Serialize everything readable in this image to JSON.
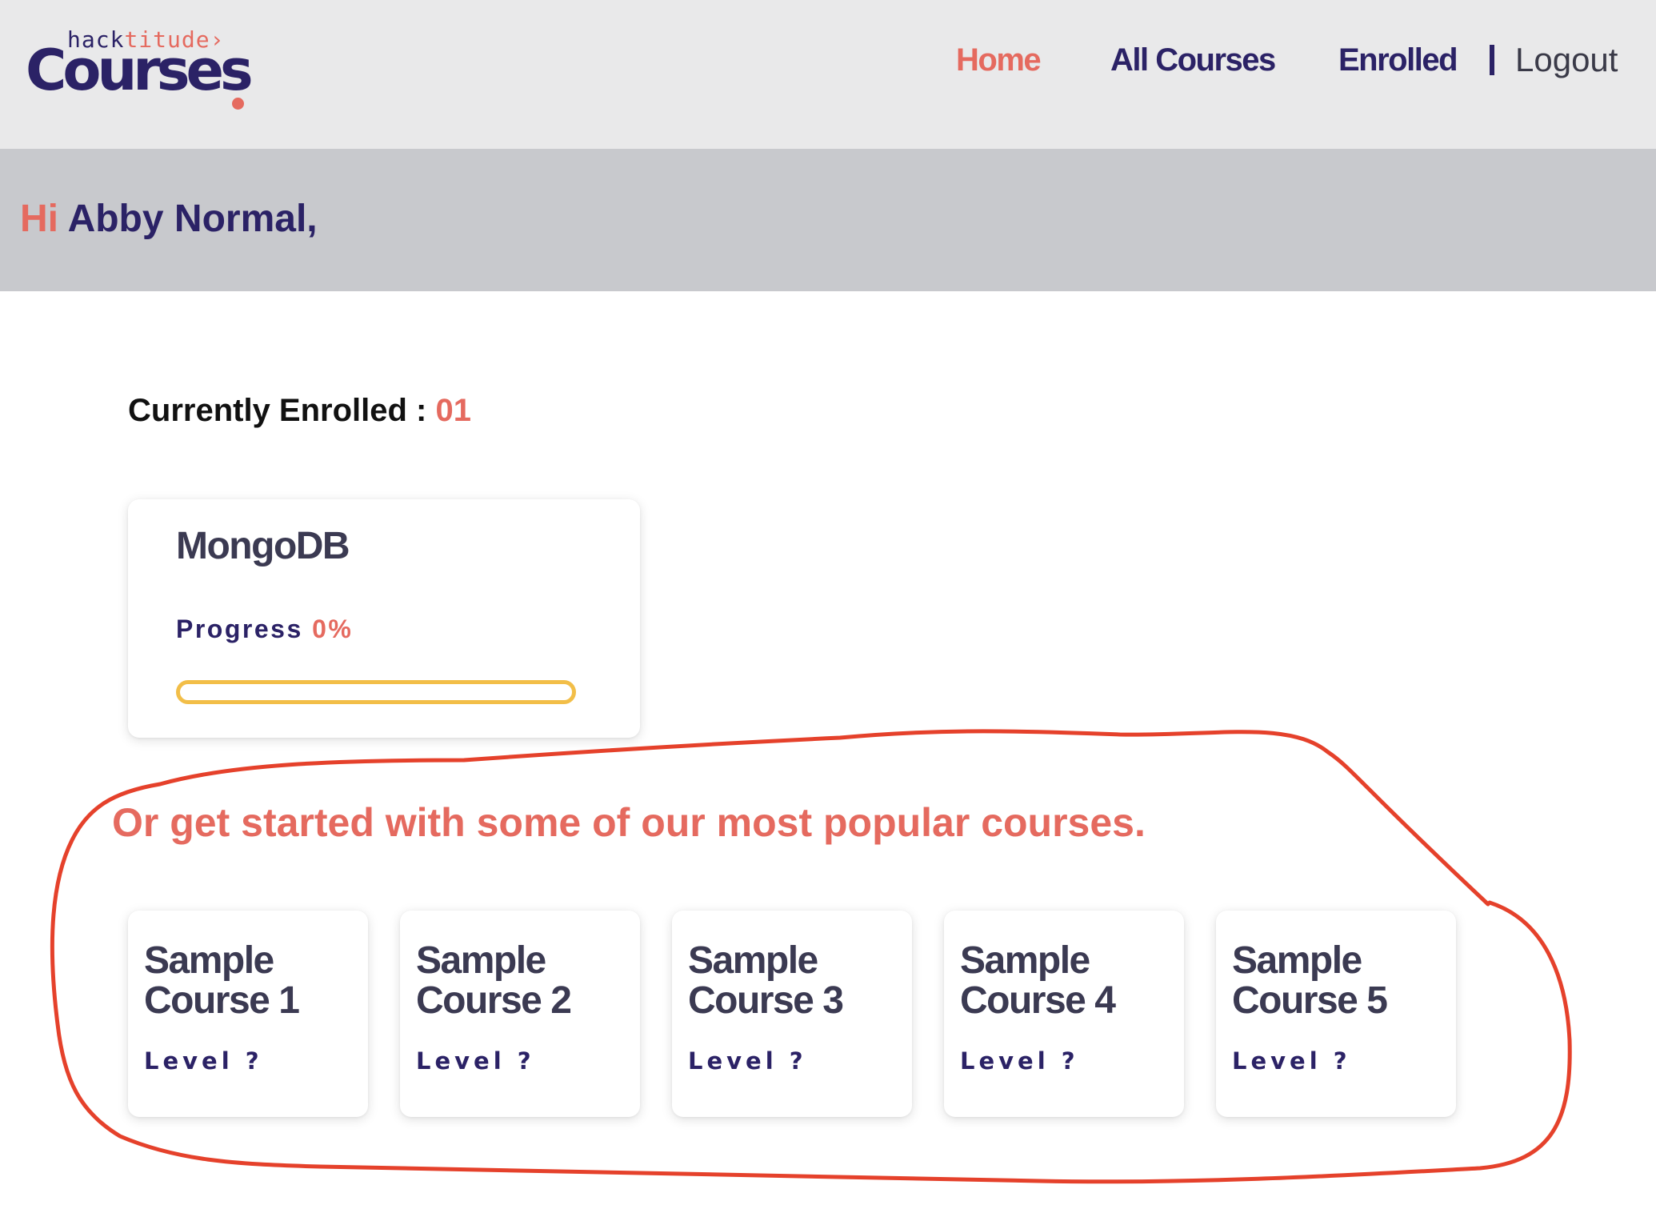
{
  "brand": {
    "logo_top_part1": "hack",
    "logo_top_part2": "titude›",
    "logo_main": "Courses",
    "accent_color": "#e56a5f",
    "primary_color": "#2b2266"
  },
  "nav": {
    "home": "Home",
    "all_courses": "All Courses",
    "enrolled": "Enrolled",
    "logout": "Logout"
  },
  "greeting": {
    "hi": "Hi",
    "name": "Abby Normal,"
  },
  "enrolled_section": {
    "heading": "Currently Enrolled :",
    "count": "01",
    "course": {
      "title": "MongoDB",
      "progress_label": "Progress",
      "progress_value": "0%",
      "progress_fraction": 0,
      "bar_color": "#f2be48"
    }
  },
  "popular_section": {
    "heading": "Or get started with some of our most popular courses.",
    "courses": [
      {
        "title": "Sample Course 1",
        "level": "Level ?"
      },
      {
        "title": "Sample Course 2",
        "level": "Level ?"
      },
      {
        "title": "Sample Course 3",
        "level": "Level ?"
      },
      {
        "title": "Sample Course 4",
        "level": "Level ?"
      },
      {
        "title": "Sample Course 5",
        "level": "Level ?"
      }
    ]
  },
  "annotation": {
    "color": "#e5412b"
  }
}
